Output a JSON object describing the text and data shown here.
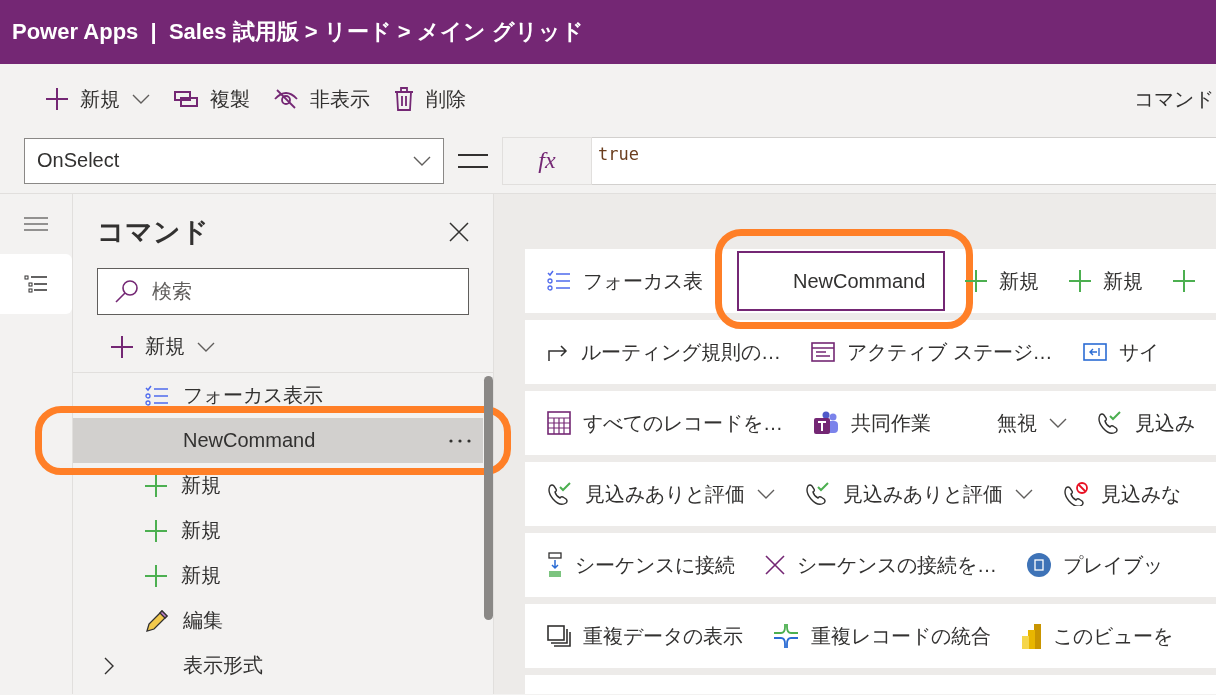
{
  "title": "Power Apps  |  Sales 試用版 > リード > メイン グリッド",
  "toolbar": {
    "items": [
      {
        "label": "新規",
        "kind": "dropdown"
      },
      {
        "label": "複製",
        "kind": "button"
      },
      {
        "label": "非表示",
        "kind": "button"
      },
      {
        "label": "削除",
        "kind": "button"
      }
    ],
    "right_label": "コマンド"
  },
  "formula_bar": {
    "property": "OnSelect",
    "fx_label": "fx",
    "formula": "true"
  },
  "rail": [
    {
      "selected": false
    },
    {
      "selected": true
    }
  ],
  "panel": {
    "title": "コマンド",
    "search_placeholder": "検索",
    "new_button": "新規",
    "items": [
      {
        "label": "フォーカス表示",
        "selected": false,
        "expandable": false
      },
      {
        "label": "NewCommand",
        "selected": true,
        "expandable": false
      },
      {
        "label": "新規",
        "selected": false,
        "expandable": false
      },
      {
        "label": "新規",
        "selected": false,
        "expandable": false
      },
      {
        "label": "新規",
        "selected": false,
        "expandable": false
      },
      {
        "label": "編集",
        "selected": false,
        "expandable": false
      },
      {
        "label": "表示形式",
        "selected": false,
        "expandable": true
      }
    ]
  },
  "canvas": {
    "rows": [
      {
        "items": [
          {
            "label": "フォーカス表",
            "kind": "button",
            "selected": false
          },
          {
            "label": "NewCommand",
            "kind": "button",
            "selected": true
          },
          {
            "label": "新規",
            "kind": "button",
            "selected": false
          },
          {
            "label": "新規",
            "kind": "button",
            "selected": false
          },
          {
            "kind": "button",
            "selected": false
          }
        ]
      },
      {
        "items": [
          {
            "label": "ルーティング規則の…",
            "kind": "button",
            "selected": false
          },
          {
            "label": "アクティブ ステージ…",
            "kind": "button",
            "selected": false
          },
          {
            "label": "サイ",
            "kind": "button",
            "selected": false
          }
        ]
      },
      {
        "items": [
          {
            "label": "すべてのレコードを…",
            "kind": "button",
            "selected": false
          },
          {
            "label": "共同作業",
            "kind": "button",
            "selected": false
          },
          {
            "label": "無視",
            "kind": "dropdown",
            "selected": false
          },
          {
            "label": "見込み",
            "kind": "button",
            "selected": false
          }
        ]
      },
      {
        "items": [
          {
            "label": "見込みありと評価",
            "kind": "dropdown",
            "selected": false
          },
          {
            "label": "見込みありと評価",
            "kind": "dropdown",
            "selected": false
          },
          {
            "label": "見込みな",
            "kind": "button",
            "selected": false
          }
        ]
      },
      {
        "items": [
          {
            "label": "シーケンスに接続",
            "kind": "button",
            "selected": false
          },
          {
            "label": "シーケンスの接続を…",
            "kind": "button",
            "selected": false
          },
          {
            "label": "プレイブッ",
            "kind": "button",
            "selected": false
          }
        ]
      },
      {
        "items": [
          {
            "label": "重複データの表示",
            "kind": "button",
            "selected": false
          },
          {
            "label": "重複レコードの統合",
            "kind": "button",
            "selected": false
          },
          {
            "label": "このビューを",
            "kind": "button",
            "selected": false
          }
        ]
      }
    ]
  }
}
